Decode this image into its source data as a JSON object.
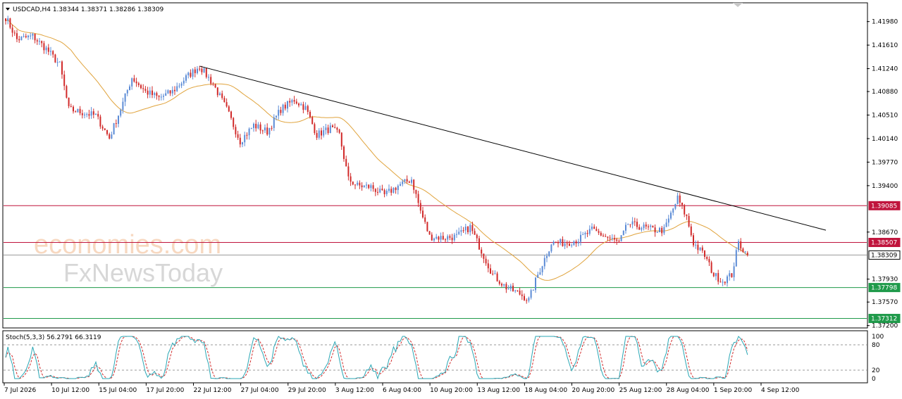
{
  "chart_data": {
    "type": "candlestick",
    "symbol": "USDCAD",
    "timeframe": "H4",
    "header": "USDCAD,H4  1.38344 1.38371 1.38286 1.38309",
    "ohlc": {
      "open": 1.38344,
      "high": 1.38371,
      "low": 1.38286,
      "close": 1.38309
    },
    "colors": {
      "bull": "#5b8bd6",
      "bear": "#d12a2a",
      "ma": "#e0a33c",
      "trendline": "#000000",
      "resistance": "#c0143c",
      "support": "#1f9a4a",
      "current": "#000000"
    },
    "y_ticks": [
      1.4198,
      1.4161,
      1.4124,
      1.4088,
      1.4051,
      1.4014,
      1.3977,
      1.394,
      1.3867,
      1.3793,
      1.3757,
      1.372
    ],
    "y_tick_labels": [
      "1.41980",
      "1.41610",
      "1.41240",
      "1.40880",
      "1.40510",
      "1.40140",
      "1.39770",
      "1.39400",
      "1.38670",
      "1.37930",
      "1.37570",
      "1.37200"
    ],
    "ylim": [
      1.37174,
      1.42264
    ],
    "levels": [
      {
        "label": "1.39085",
        "value": 1.39085,
        "kind": "resistance"
      },
      {
        "label": "1.38507",
        "value": 1.38507,
        "kind": "resistance"
      },
      {
        "label": "1.38309",
        "value": 1.38309,
        "kind": "current"
      },
      {
        "label": "1.37798",
        "value": 1.37798,
        "kind": "support"
      },
      {
        "label": "1.37312",
        "value": 1.37312,
        "kind": "support"
      }
    ],
    "x_labels": [
      "7 Jul 2026",
      "10 Jul 12:00",
      "15 Jul 04:00",
      "17 Jul 20:00",
      "22 Jul 12:00",
      "27 Jul 04:00",
      "29 Jul 20:00",
      "3 Aug 12:00",
      "6 Aug 04:00",
      "10 Aug 20:00",
      "13 Aug 12:00",
      "18 Aug 04:00",
      "20 Aug 20:00",
      "25 Aug 12:00",
      "28 Aug 04:00",
      "1 Sep 20:00",
      "4 Sep 12:00"
    ],
    "trendline": {
      "from": 1.4128,
      "to": 1.387
    },
    "anchors_close": [
      [
        0,
        1.4205
      ],
      [
        5,
        1.417
      ],
      [
        12,
        1.4175
      ],
      [
        18,
        1.4155
      ],
      [
        24,
        1.413
      ],
      [
        28,
        1.406
      ],
      [
        34,
        1.4055
      ],
      [
        40,
        1.405
      ],
      [
        46,
        1.4015
      ],
      [
        52,
        1.407
      ],
      [
        56,
        1.411
      ],
      [
        62,
        1.4088
      ],
      [
        68,
        1.4078
      ],
      [
        74,
        1.4088
      ],
      [
        80,
        1.411
      ],
      [
        86,
        1.4128
      ],
      [
        92,
        1.41
      ],
      [
        98,
        1.406
      ],
      [
        104,
        1.401
      ],
      [
        110,
        1.4035
      ],
      [
        116,
        1.4025
      ],
      [
        122,
        1.406
      ],
      [
        128,
        1.4075
      ],
      [
        133,
        1.4062
      ],
      [
        138,
        1.402
      ],
      [
        144,
        1.403
      ],
      [
        148,
        1.402
      ],
      [
        152,
        1.395
      ],
      [
        156,
        1.394
      ],
      [
        162,
        1.3938
      ],
      [
        168,
        1.3925
      ],
      [
        174,
        1.394
      ],
      [
        180,
        1.395
      ],
      [
        184,
        1.39
      ],
      [
        188,
        1.386
      ],
      [
        194,
        1.3858
      ],
      [
        200,
        1.386
      ],
      [
        206,
        1.3875
      ],
      [
        212,
        1.383
      ],
      [
        216,
        1.38
      ],
      [
        222,
        1.378
      ],
      [
        228,
        1.377
      ],
      [
        232,
        1.376
      ],
      [
        236,
        1.38
      ],
      [
        242,
        1.385
      ],
      [
        248,
        1.385
      ],
      [
        254,
        1.3855
      ],
      [
        260,
        1.387
      ],
      [
        266,
        1.386
      ],
      [
        272,
        1.385
      ],
      [
        276,
        1.388
      ],
      [
        282,
        1.3875
      ],
      [
        288,
        1.387
      ],
      [
        292,
        1.387
      ],
      [
        298,
        1.392
      ],
      [
        302,
        1.389
      ],
      [
        305,
        1.385
      ],
      [
        310,
        1.383
      ],
      [
        314,
        1.38
      ],
      [
        318,
        1.379
      ],
      [
        322,
        1.38
      ],
      [
        325,
        1.385
      ],
      [
        328,
        1.3835
      ],
      [
        329,
        1.38309
      ]
    ],
    "stochastic": {
      "label": "Stoch(5,3,3) 56.2791 66.3119",
      "main": 56.2791,
      "signal": 66.3119,
      "levels": [
        80,
        20
      ],
      "y_labels": [
        "100",
        "80",
        "20",
        "0"
      ],
      "colors": {
        "main": "#2aa7b5",
        "signal": "#d12a2a"
      }
    }
  },
  "levels_display": [
    "1.39085",
    "1.38507",
    "1.38309",
    "1.37798",
    "1.37312"
  ],
  "watermark": {
    "line1": "economies.com",
    "line2": "FxNewsToday"
  }
}
